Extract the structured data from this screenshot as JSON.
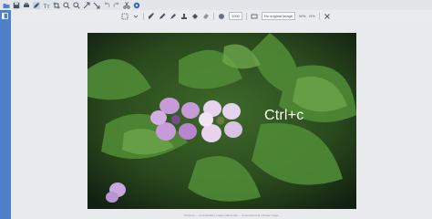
{
  "toolbar": {
    "icons": [
      "open-folder-icon",
      "save-icon",
      "print-icon",
      "edit-pen-icon",
      "text-icon",
      "crop-icon",
      "zoom-in-icon",
      "zoom-out-icon",
      "arrow-icon",
      "arrow-icon",
      "undo-icon",
      "redo-icon",
      "scissors-icon",
      "color-wheel-icon"
    ]
  },
  "subbar": {
    "size_field": "1000",
    "bg_field": "No original image",
    "ratio_label": "W%",
    "ratio2_label": "H%"
  },
  "overlay": {
    "text": "Ctrl+c"
  },
  "footer": {
    "text": "Photo by ... on Unsplash  |  Image edited with ... screenshot tool  |  Flower image"
  },
  "colors": {
    "sidebar": "#4f7ecb",
    "toolbar": "#e2e5ea",
    "canvas": "#e8eaee"
  }
}
